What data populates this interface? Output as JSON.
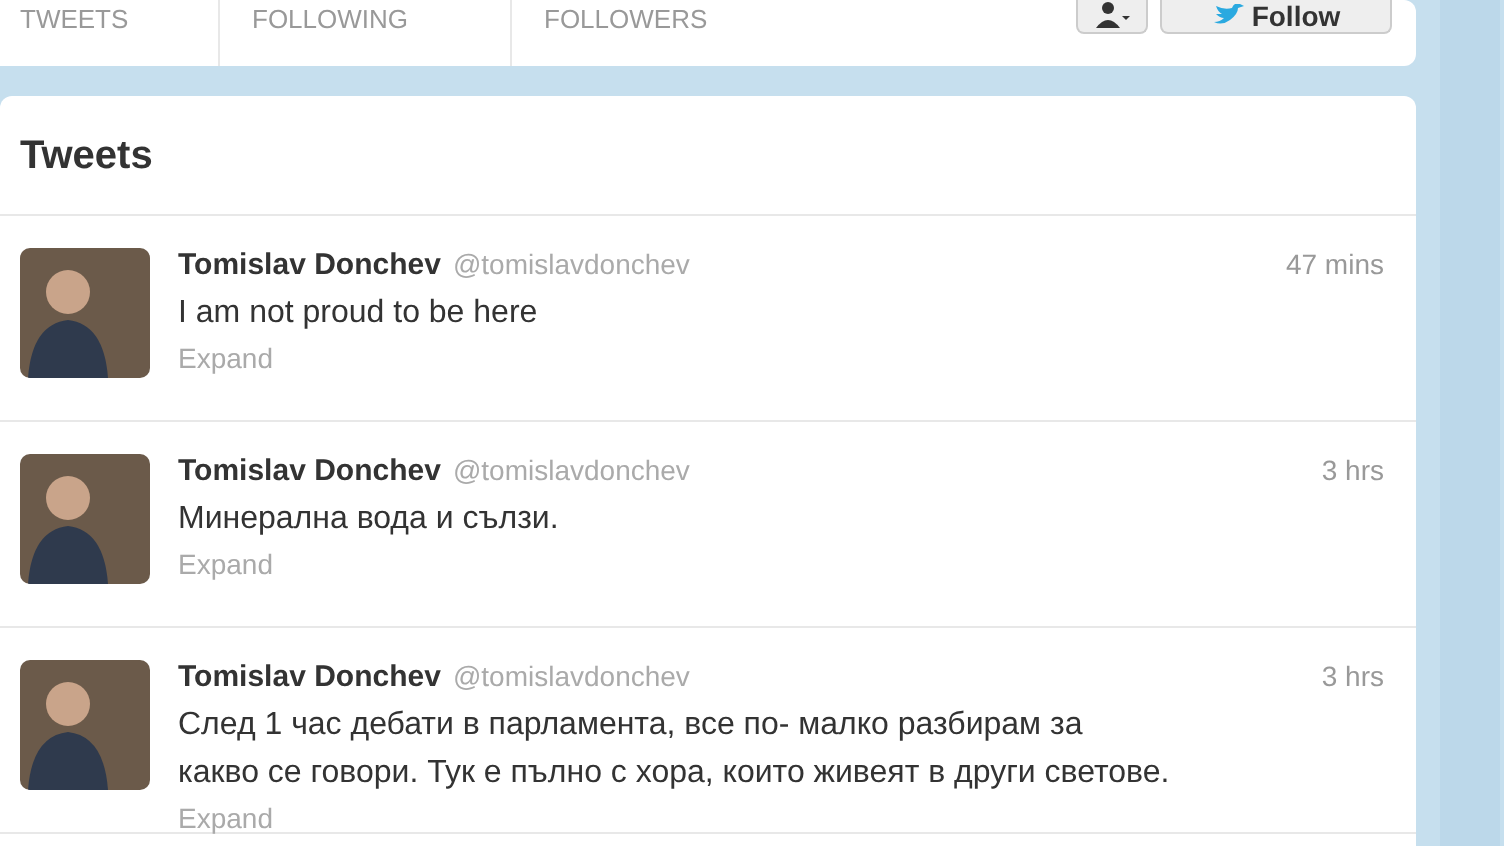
{
  "profile_stats": [
    {
      "label": "TWEETS"
    },
    {
      "label": "FOLLOWING"
    },
    {
      "label": "FOLLOWERS"
    }
  ],
  "follow_button": {
    "label": "Follow"
  },
  "tweets_section": {
    "title": "Tweets",
    "tweets": [
      {
        "name": "Tomislav Donchev",
        "handle": "@tomislavdonchev",
        "time": "47 mins",
        "text": "I am not proud to be here",
        "action": "Expand"
      },
      {
        "name": "Tomislav Donchev",
        "handle": "@tomislavdonchev",
        "time": "3 hrs",
        "text": "Минерална вода и сълзи.",
        "action": "Expand"
      },
      {
        "name": "Tomislav Donchev",
        "handle": "@tomislavdonchev",
        "time": "3 hrs",
        "text": "След 1 час дебати в парламента, все по- малко разбирам за\nкакво се говори. Тук е пълно с хора, които живеят в други светове.",
        "action": "Expand"
      }
    ]
  }
}
